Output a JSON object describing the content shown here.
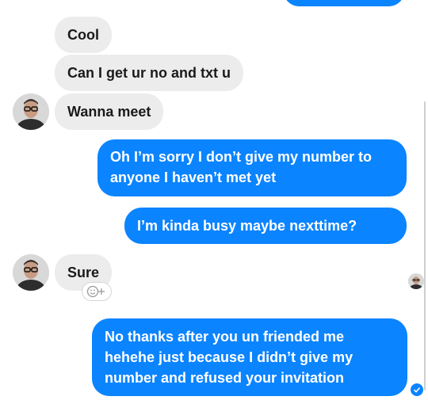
{
  "conversation": {
    "messages": [
      {
        "text": "Cool"
      },
      {
        "text": "Can I get ur no and txt u"
      },
      {
        "text": "Wanna meet"
      },
      {
        "text": "Oh I’m sorry I don’t give my number to anyone I haven’t met yet"
      },
      {
        "text": "I’m kinda busy maybe nexttime?"
      },
      {
        "text": "Sure"
      },
      {
        "text": "No thanks after you un friended me hehehe just because I didn’t give my number and refused your invitation"
      }
    ]
  },
  "colors": {
    "incoming_bubble": "#ececed",
    "outgoing_bubble": "#0b84ff",
    "incoming_text": "#1a1a1a",
    "outgoing_text": "#ffffff"
  },
  "icons": {
    "avatar": "contact-avatar-icon",
    "reaction": "add-reaction-icon",
    "read_receipt": "read-receipt-icon",
    "seen": "seen-avatar-icon"
  }
}
